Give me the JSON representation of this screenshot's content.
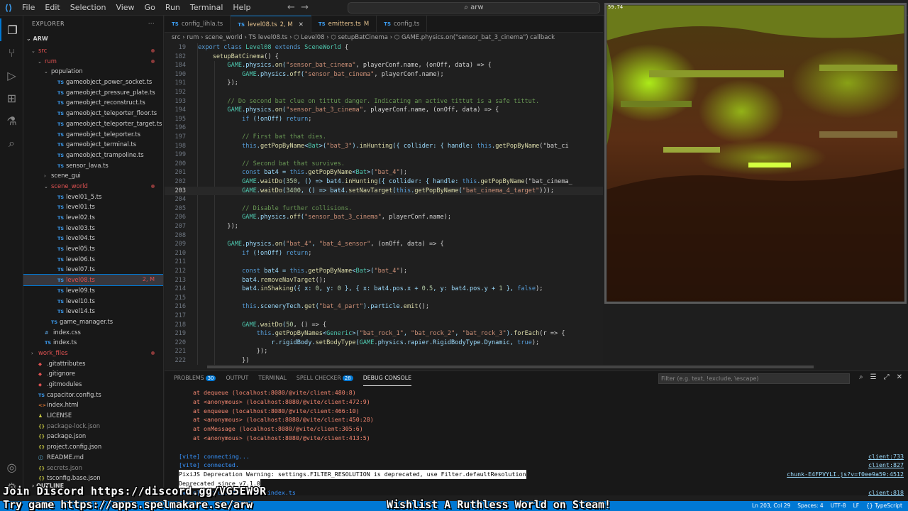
{
  "titlebar": {
    "menu": [
      "File",
      "Edit",
      "Selection",
      "View",
      "Go",
      "Run",
      "Terminal",
      "Help"
    ],
    "search": "arw"
  },
  "activity": {
    "icons": [
      "explorer-icon",
      "source-control-icon",
      "run-debug-icon",
      "extensions-icon",
      "testing-icon",
      "search-icon"
    ],
    "bottom_icons": [
      "account-icon",
      "settings-gear-icon"
    ]
  },
  "sidebar": {
    "title": "EXPLORER",
    "root": "ARW",
    "outline": "OUTLINE",
    "tree": [
      {
        "depth": 1,
        "kind": "folder",
        "open": true,
        "label": "src",
        "mod": true
      },
      {
        "depth": 2,
        "kind": "folder",
        "open": true,
        "label": "rum",
        "mod": true
      },
      {
        "depth": 3,
        "kind": "folder",
        "open": true,
        "label": "population"
      },
      {
        "depth": 4,
        "kind": "ts",
        "label": "gameobject_power_socket.ts"
      },
      {
        "depth": 4,
        "kind": "ts",
        "label": "gameobject_pressure_plate.ts"
      },
      {
        "depth": 4,
        "kind": "ts",
        "label": "gameobject_reconstruct.ts"
      },
      {
        "depth": 4,
        "kind": "ts",
        "label": "gameobject_teleporter_floor.ts"
      },
      {
        "depth": 4,
        "kind": "ts",
        "label": "gameobject_teleporter_target.ts"
      },
      {
        "depth": 4,
        "kind": "ts",
        "label": "gameobject_teleporter.ts"
      },
      {
        "depth": 4,
        "kind": "ts",
        "label": "gameobject_terminal.ts"
      },
      {
        "depth": 4,
        "kind": "ts",
        "label": "gameobject_trampoline.ts"
      },
      {
        "depth": 4,
        "kind": "ts",
        "label": "sensor_lava.ts"
      },
      {
        "depth": 3,
        "kind": "folder",
        "open": false,
        "label": "scene_gui"
      },
      {
        "depth": 3,
        "kind": "folder",
        "open": true,
        "label": "scene_world",
        "mod": true
      },
      {
        "depth": 4,
        "kind": "ts",
        "label": "level01_5.ts"
      },
      {
        "depth": 4,
        "kind": "ts",
        "label": "level01.ts"
      },
      {
        "depth": 4,
        "kind": "ts",
        "label": "level02.ts"
      },
      {
        "depth": 4,
        "kind": "ts",
        "label": "level03.ts"
      },
      {
        "depth": 4,
        "kind": "ts",
        "label": "level04.ts"
      },
      {
        "depth": 4,
        "kind": "ts",
        "label": "level05.ts"
      },
      {
        "depth": 4,
        "kind": "ts",
        "label": "level06.ts"
      },
      {
        "depth": 4,
        "kind": "ts",
        "label": "level07.ts"
      },
      {
        "depth": 4,
        "kind": "ts",
        "label": "level08.ts",
        "selected": true,
        "status": "2, M"
      },
      {
        "depth": 4,
        "kind": "ts",
        "label": "level09.ts"
      },
      {
        "depth": 4,
        "kind": "ts",
        "label": "level10.ts"
      },
      {
        "depth": 4,
        "kind": "ts",
        "label": "level14.ts"
      },
      {
        "depth": 3,
        "kind": "ts",
        "label": "game_manager.ts"
      },
      {
        "depth": 2,
        "kind": "css",
        "label": "index.css"
      },
      {
        "depth": 2,
        "kind": "ts",
        "label": "index.ts"
      },
      {
        "depth": 1,
        "kind": "folder",
        "open": false,
        "label": "work_files",
        "mod": true
      },
      {
        "depth": 1,
        "kind": "git",
        "label": ".gitattributes"
      },
      {
        "depth": 1,
        "kind": "git",
        "label": ".gitignore"
      },
      {
        "depth": 1,
        "kind": "git",
        "label": ".gitmodules"
      },
      {
        "depth": 1,
        "kind": "ts",
        "label": "capacitor.config.ts"
      },
      {
        "depth": 1,
        "kind": "html",
        "label": "index.html"
      },
      {
        "depth": 1,
        "kind": "lic",
        "label": "LICENSE"
      },
      {
        "depth": 1,
        "kind": "json",
        "label": "package-lock.json",
        "dim": true
      },
      {
        "depth": 1,
        "kind": "json",
        "label": "package.json"
      },
      {
        "depth": 1,
        "kind": "json",
        "label": "project.config.json"
      },
      {
        "depth": 1,
        "kind": "md",
        "label": "README.md"
      },
      {
        "depth": 1,
        "kind": "json",
        "label": "secrets.json",
        "dim": true
      },
      {
        "depth": 1,
        "kind": "json",
        "label": "tsconfig.base.json"
      }
    ]
  },
  "tabs": [
    {
      "label": "config_lihla.ts",
      "active": false
    },
    {
      "label": "level08.ts",
      "suffix": "2, M",
      "active": true
    },
    {
      "label": "emitters.ts",
      "suffix": "M",
      "active": false
    },
    {
      "label": "config.ts",
      "active": false
    }
  ],
  "breadcrumb": "src › rum › scene_world › TS level08.ts › ⬡ Level08 › ⬡ setupBatCinema › ⬡ GAME.physics.on(\"sensor_bat_3_cinema\") callback",
  "code": [
    {
      "n": "19",
      "t": "export class Level08 extends SceneWorld {"
    },
    {
      "n": "182",
      "t": "    setupBatCinema() {"
    },
    {
      "n": "184",
      "t": "        GAME.physics.on(\"sensor_bat_cinema\", playerConf.name, (onOff, data) => {"
    },
    {
      "n": "190",
      "t": "            GAME.physics.off(\"sensor_bat_cinema\", playerConf.name);"
    },
    {
      "n": "191",
      "t": "        });"
    },
    {
      "n": "192",
      "t": ""
    },
    {
      "n": "193",
      "t": "        // Do second bat clue on tittut danger. Indicating an active tittut is a safe tittut."
    },
    {
      "n": "194",
      "t": "        GAME.physics.on(\"sensor_bat_3_cinema\", playerConf.name, (onOff, data) => {"
    },
    {
      "n": "195",
      "t": "            if (!onOff) return;"
    },
    {
      "n": "196",
      "t": ""
    },
    {
      "n": "197",
      "t": "            // First bat that dies."
    },
    {
      "n": "198",
      "t": "            this.getPopByName<Bat>(\"bat_3\").inHunting({ collider: { handle: this.getPopByName(\"bat_ci"
    },
    {
      "n": "199",
      "t": ""
    },
    {
      "n": "200",
      "t": "            // Second bat that survives."
    },
    {
      "n": "201",
      "t": "            const bat4 = this.getPopByName<Bat>(\"bat_4\");"
    },
    {
      "n": "202",
      "t": "            GAME.waitDo(350, () => bat4.inHunting({ collider: { handle: this.getPopByName(\"bat_cinema_"
    },
    {
      "n": "203",
      "t": "            GAME.waitDo(3400, () => bat4.setNavTarget(this.getPopByName(\"bat_cinema_4_target\")));",
      "cur": true
    },
    {
      "n": "204",
      "t": ""
    },
    {
      "n": "205",
      "t": "            // Disable further collisions."
    },
    {
      "n": "206",
      "t": "            GAME.physics.off(\"sensor_bat_3_cinema\", playerConf.name);"
    },
    {
      "n": "207",
      "t": "        });"
    },
    {
      "n": "208",
      "t": ""
    },
    {
      "n": "209",
      "t": "        GAME.physics.on(\"bat_4\", \"bat_4_sensor\", (onOff, data) => {"
    },
    {
      "n": "210",
      "t": "            if (!onOff) return;"
    },
    {
      "n": "211",
      "t": ""
    },
    {
      "n": "212",
      "t": "            const bat4 = this.getPopByName<Bat>(\"bat_4\");"
    },
    {
      "n": "213",
      "t": "            bat4.removeNavTarget();"
    },
    {
      "n": "214",
      "t": "            bat4.inShaking({ x: 0, y: 0 }, { x: bat4.pos.x + 0.5, y: bat4.pos.y + 1 }, false);"
    },
    {
      "n": "215",
      "t": ""
    },
    {
      "n": "216",
      "t": "            this.sceneryTech.get(\"bat_4_part\").particle.emit();"
    },
    {
      "n": "217",
      "t": ""
    },
    {
      "n": "218",
      "t": "            GAME.waitDo(50, () => {"
    },
    {
      "n": "219",
      "t": "                this.getPopByNames<Generic>(\"bat_rock_1\", \"bat_rock_2\", \"bat_rock_3\").forEach(r => {"
    },
    {
      "n": "220",
      "t": "                    r.rigidBody.setBodyType(GAME.physics.rapier.RigidBodyType.Dynamic, true);"
    },
    {
      "n": "221",
      "t": "                });"
    },
    {
      "n": "222",
      "t": "            })"
    }
  ],
  "game": {
    "fps": "59.74"
  },
  "panel": {
    "tabs": [
      {
        "label": "PROBLEMS",
        "badge": "30"
      },
      {
        "label": "OUTPUT"
      },
      {
        "label": "TERMINAL"
      },
      {
        "label": "SPELL CHECKER",
        "badge": "28"
      },
      {
        "label": "DEBUG CONSOLE",
        "active": true
      }
    ],
    "filter_placeholder": "Filter (e.g. text, !exclude, \\escape)",
    "lines": [
      {
        "t": "    at dequeue (localhost:8080/@vite/client:480:8)",
        "c": "#f48771"
      },
      {
        "t": "    at <anonymous> (localhost:8080/@vite/client:472:9)",
        "c": "#f48771"
      },
      {
        "t": "    at enqueue (localhost:8080/@vite/client:466:10)",
        "c": "#f48771"
      },
      {
        "t": "    at <anonymous> (localhost:8080/@vite/client:450:28)",
        "c": "#f48771"
      },
      {
        "t": "    at onMessage (localhost:8080/@vite/client:305:6)",
        "c": "#f48771"
      },
      {
        "t": "    at <anonymous> (localhost:8080/@vite/client:413:5)",
        "c": "#f48771"
      },
      {
        "t": "",
        "c": "#ccc"
      },
      {
        "t": "[vite] connecting...",
        "c": "#3794ff",
        "r": "client:733"
      },
      {
        "t": "[vite] connected.",
        "c": "#3794ff",
        "r": "client:827"
      },
      {
        "t": "PixiJS Deprecation Warning: settings.FILTER_RESOLUTION is deprecated, use Filter.defaultResolution",
        "c": "#000",
        "hl": true,
        "r": "chunk-E4FPVYLI.js?v=f0ee9a59:4512"
      },
      {
        "t": "Deprecated since v7.1.0",
        "c": "#000",
        "hl": true
      },
      {
        "t": "[vite] hot updated: /src/index.ts",
        "c": "#3794ff",
        "r": "client:818"
      }
    ]
  },
  "status": {
    "right": [
      "Ln 203, Col 29",
      "Spaces: 4",
      "UTF-8",
      "LF",
      "{} TypeScript"
    ]
  },
  "overlay": {
    "line1": "Join Discord https://discord.gg/VG5EW9R",
    "line2": "Try game https://apps.spelmakare.se/arw",
    "line3": "Wishlist A Ruthless World on Steam!"
  },
  "colors": {
    "accent": "#0078d4",
    "keyword": "#569cd6",
    "string": "#ce9178",
    "comment": "#6a9955",
    "func": "#dcdcaa",
    "type": "#4ec9b0",
    "num": "#b5cea8",
    "lime": "#b6ff1a"
  }
}
